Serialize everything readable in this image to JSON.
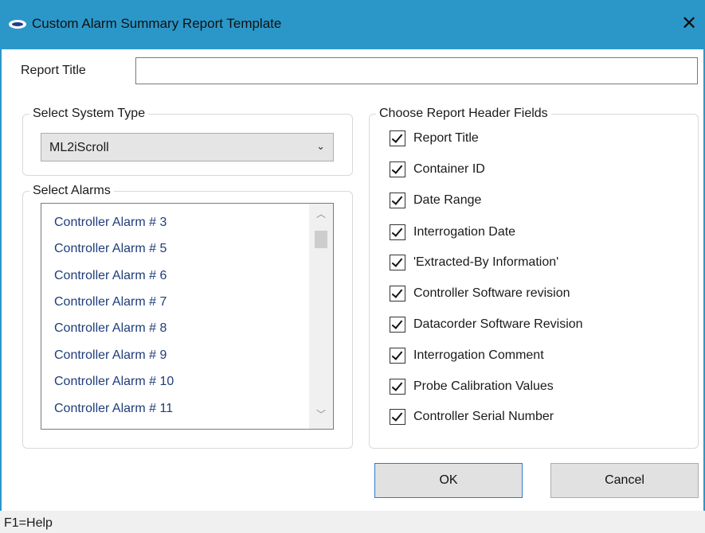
{
  "window": {
    "title": "Custom Alarm Summary Report Template",
    "close_glyph": "✕",
    "accent_color": "#2b97c9"
  },
  "report_title": {
    "label": "Report Title",
    "value": ""
  },
  "system_type": {
    "group_label": "Select System Type",
    "selected": "ML2iScroll",
    "arrow_glyph": "⌄"
  },
  "alarms": {
    "group_label": "Select Alarms",
    "items": [
      "Controller Alarm # 3",
      "Controller Alarm # 5",
      "Controller Alarm # 6",
      "Controller Alarm # 7",
      "Controller Alarm # 8",
      "Controller Alarm # 9",
      "Controller Alarm # 10",
      "Controller Alarm # 11"
    ],
    "scroll_up_glyph": "︿",
    "scroll_down_glyph": "﹀"
  },
  "header_fields": {
    "group_label": "Choose Report Header Fields",
    "items": [
      {
        "label": "Report Title",
        "checked": true
      },
      {
        "label": "Container ID",
        "checked": true
      },
      {
        "label": "Date Range",
        "checked": true
      },
      {
        "label": "Interrogation Date",
        "checked": true
      },
      {
        "label": "'Extracted-By Information'",
        "checked": true
      },
      {
        "label": "Controller Software revision",
        "checked": true
      },
      {
        "label": "Datacorder Software Revision",
        "checked": true
      },
      {
        "label": "Interrogation Comment",
        "checked": true
      },
      {
        "label": "Probe Calibration Values",
        "checked": true
      },
      {
        "label": "Controller Serial Number",
        "checked": true
      }
    ]
  },
  "buttons": {
    "ok": "OK",
    "cancel": "Cancel"
  },
  "status_bar": {
    "text": "F1=Help"
  }
}
